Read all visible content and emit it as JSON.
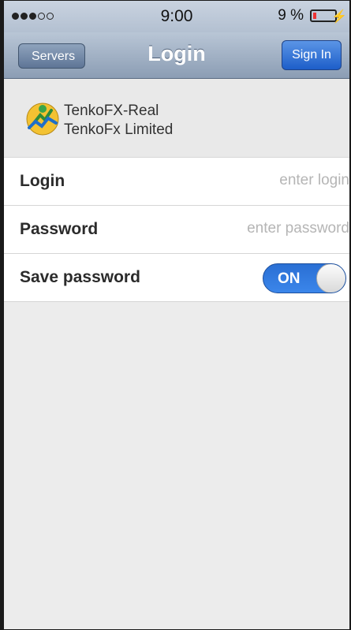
{
  "status_bar": {
    "time": "9:00",
    "battery_percent": "9 %",
    "signal_bars_filled": 3,
    "signal_bars_total": 5
  },
  "nav": {
    "back_label": "Servers",
    "title": "Login",
    "action_label": "Sign In"
  },
  "server": {
    "name": "TenkoFX-Real",
    "company": "TenkoFx Limited",
    "icon": "metatrader-logo-icon"
  },
  "form": {
    "login": {
      "label": "Login",
      "placeholder": "enter login",
      "value": ""
    },
    "password": {
      "label": "Password",
      "placeholder": "enter password",
      "value": ""
    },
    "save_password": {
      "label": "Save password",
      "toggle_text": "ON",
      "enabled": true
    }
  },
  "colors": {
    "nav_gradient_top": "#b9c6d6",
    "nav_gradient_bottom": "#8b9db4",
    "accent_blue": "#2a6fd4",
    "background": "#ececec"
  }
}
